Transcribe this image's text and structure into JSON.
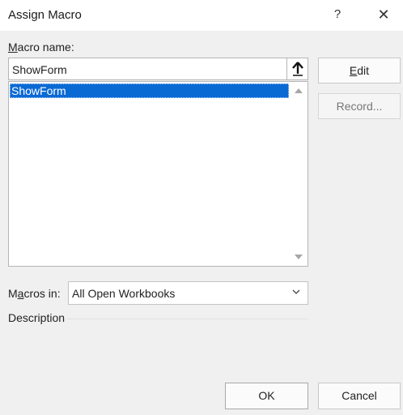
{
  "window": {
    "title": "Assign Macro",
    "help_label": "?",
    "close_label": "✕"
  },
  "macro_name": {
    "label_underlined": "M",
    "label_rest": "acro name:",
    "value": "ShowForm"
  },
  "macro_list": {
    "items": [
      "ShowForm"
    ],
    "selected_index": 0
  },
  "buttons": {
    "edit_underlined": "E",
    "edit_rest": "dit",
    "record": "Record...",
    "ok": "OK",
    "cancel": "Cancel"
  },
  "macros_in": {
    "label_pre": "M",
    "label_underlined": "a",
    "label_rest": "cros in:",
    "value": "All Open Workbooks"
  },
  "description": {
    "label": "Description"
  },
  "colors": {
    "selection": "#0a6ad4",
    "dialog_bg": "#f0f0f0"
  }
}
